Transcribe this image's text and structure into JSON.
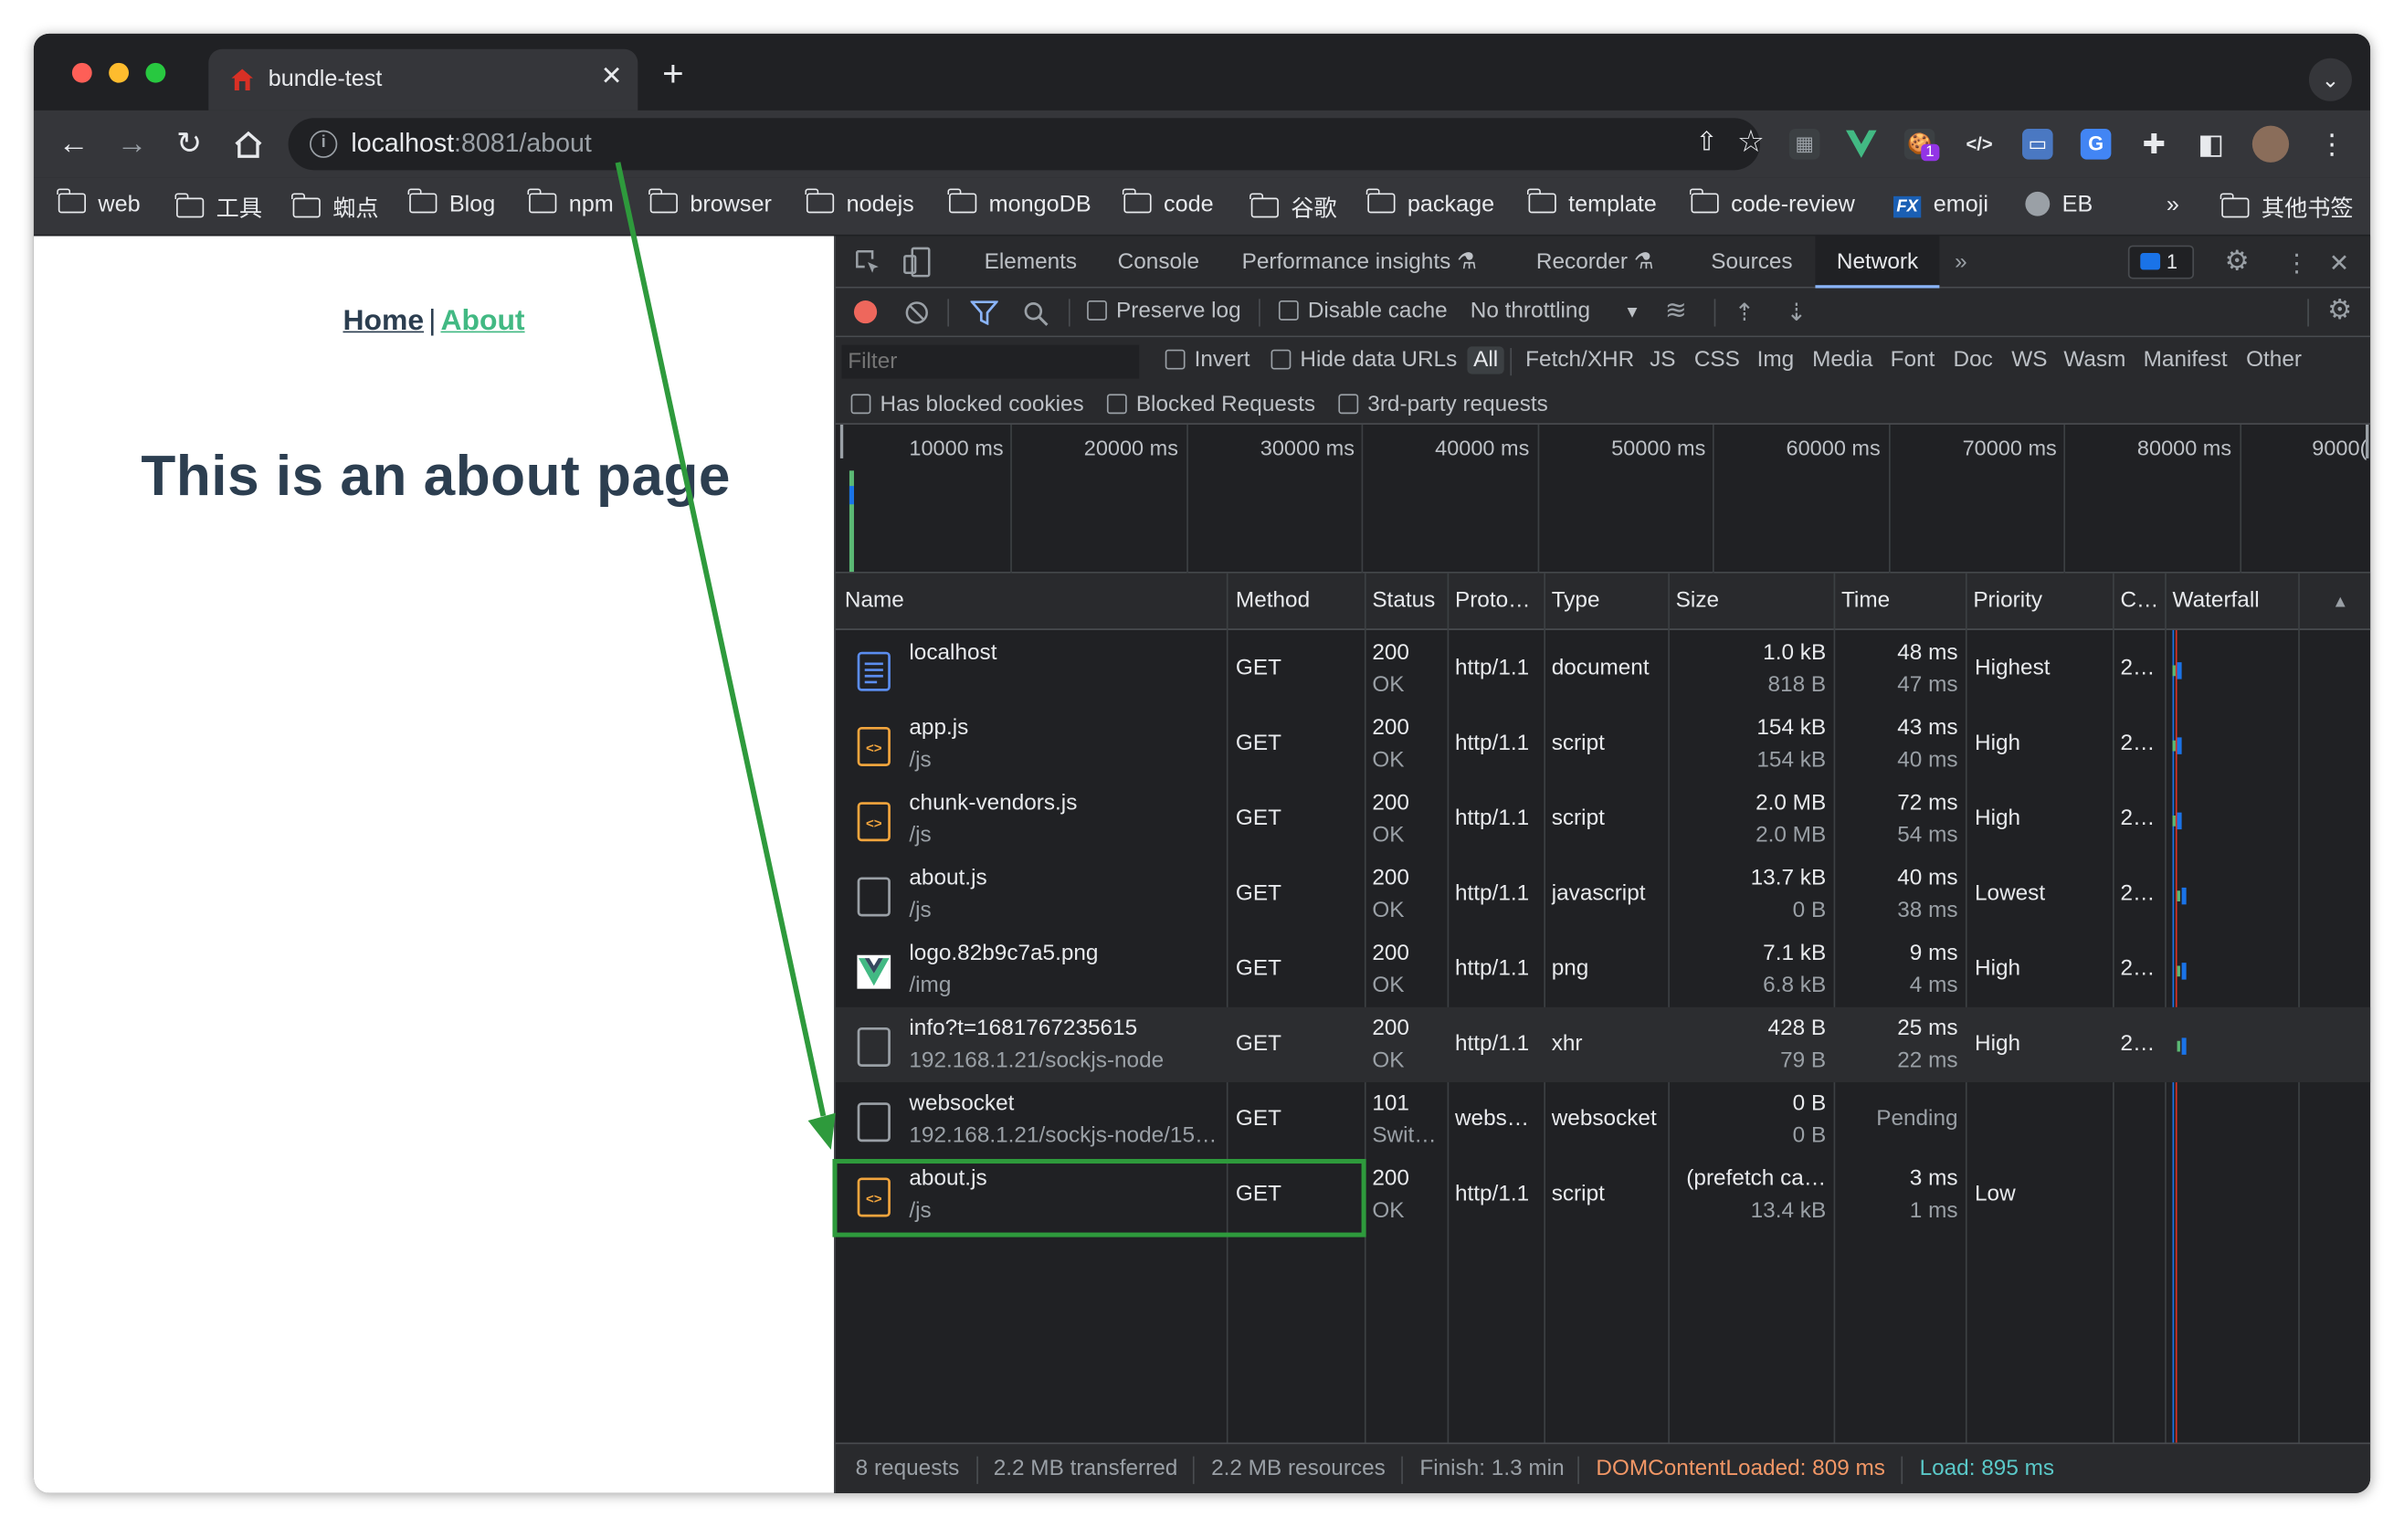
{
  "browser": {
    "tab_title": "bundle-test",
    "tab_close": "✕",
    "new_tab": "+",
    "tab_menu": "⌄",
    "url_host": "localhost",
    "url_rest": ":8081/about",
    "extension_badge": "1"
  },
  "bookmarks": [
    {
      "label": "web"
    },
    {
      "label": "工具"
    },
    {
      "label": "蜘点"
    },
    {
      "label": "Blog"
    },
    {
      "label": "npm"
    },
    {
      "label": "browser"
    },
    {
      "label": "nodejs"
    },
    {
      "label": "mongoDB"
    },
    {
      "label": "code"
    },
    {
      "label": "谷歌"
    },
    {
      "label": "package"
    },
    {
      "label": "template"
    },
    {
      "label": "code-review"
    },
    {
      "label": "emoji"
    },
    {
      "label": "EB"
    }
  ],
  "bookmarks_more": "»",
  "bookmarks_other": "其他书签",
  "page": {
    "nav_home": "Home",
    "nav_sep": "|",
    "nav_about": "About",
    "heading": "This is an about page"
  },
  "devtools": {
    "tabs": [
      "Elements",
      "Console",
      "Performance insights",
      "Recorder",
      "Sources",
      "Network"
    ],
    "active_tab": "Network",
    "more_tabs": "»",
    "message_count": "1",
    "toolbar": {
      "preserve_log": "Preserve log",
      "disable_cache": "Disable cache",
      "throttling": "No throttling"
    },
    "filter": {
      "placeholder": "Filter",
      "invert": "Invert",
      "hide_data_urls": "Hide data URLs",
      "types": [
        "All",
        "Fetch/XHR",
        "JS",
        "CSS",
        "Img",
        "Media",
        "Font",
        "Doc",
        "WS",
        "Wasm",
        "Manifest",
        "Other"
      ],
      "has_blocked_cookies": "Has blocked cookies",
      "blocked_requests": "Blocked Requests",
      "third_party": "3rd-party requests"
    },
    "overview_ticks": [
      "10000 ms",
      "20000 ms",
      "30000 ms",
      "40000 ms",
      "50000 ms",
      "60000 ms",
      "70000 ms",
      "80000 ms",
      "9000("
    ],
    "columns": [
      "Name",
      "Method",
      "Status",
      "Proto…",
      "Type",
      "Size",
      "Time",
      "Priority",
      "C…",
      "Waterfall"
    ],
    "requests": [
      {
        "name": "localhost",
        "path": "",
        "method": "GET",
        "status": "200",
        "status_text": "OK",
        "protocol": "http/1.1",
        "type": "document",
        "size": "1.0 kB",
        "size2": "818 B",
        "time": "48 ms",
        "time2": "47 ms",
        "priority": "Highest",
        "c": "2…",
        "icon": "document-icon",
        "waterfall": 0.3
      },
      {
        "name": "app.js",
        "path": "/js",
        "method": "GET",
        "status": "200",
        "status_text": "OK",
        "protocol": "http/1.1",
        "type": "script",
        "size": "154 kB",
        "size2": "154 kB",
        "time": "43 ms",
        "time2": "40 ms",
        "priority": "High",
        "c": "2…",
        "icon": "script-icon",
        "waterfall": 0.3
      },
      {
        "name": "chunk-vendors.js",
        "path": "/js",
        "method": "GET",
        "status": "200",
        "status_text": "OK",
        "protocol": "http/1.1",
        "type": "script",
        "size": "2.0 MB",
        "size2": "2.0 MB",
        "time": "72 ms",
        "time2": "54 ms",
        "priority": "High",
        "c": "2…",
        "icon": "script-icon",
        "waterfall": 0.3
      },
      {
        "name": "about.js",
        "path": "/js",
        "method": "GET",
        "status": "200",
        "status_text": "OK",
        "protocol": "http/1.1",
        "type": "javascript",
        "size": "13.7 kB",
        "size2": "0 B",
        "time": "40 ms",
        "time2": "38 ms",
        "priority": "Lowest",
        "c": "2…",
        "icon": "blank-file-icon",
        "waterfall": 0.6
      },
      {
        "name": "logo.82b9c7a5.png",
        "path": "/img",
        "method": "GET",
        "status": "200",
        "status_text": "OK",
        "protocol": "http/1.1",
        "type": "png",
        "size": "7.1 kB",
        "size2": "6.8 kB",
        "time": "9 ms",
        "time2": "4 ms",
        "priority": "High",
        "c": "2…",
        "icon": "vue-logo-icon",
        "waterfall": 0.6
      },
      {
        "name": "info?t=1681767235615",
        "path": "192.168.1.21/sockjs-node",
        "method": "GET",
        "status": "200",
        "status_text": "OK",
        "protocol": "http/1.1",
        "type": "xhr",
        "size": "428 B",
        "size2": "79 B",
        "time": "25 ms",
        "time2": "22 ms",
        "priority": "High",
        "c": "2…",
        "icon": "blank-file-icon",
        "waterfall": 0.6
      },
      {
        "name": "websocket",
        "path": "192.168.1.21/sockjs-node/15…",
        "method": "GET",
        "status": "101",
        "status_text": "Swit…",
        "protocol": "webs…",
        "type": "websocket",
        "size": "0 B",
        "size2": "0 B",
        "time": "Pending",
        "time2": "",
        "priority": "",
        "c": "",
        "icon": "blank-file-icon",
        "waterfall": null
      },
      {
        "name": "about.js",
        "path": "/js",
        "method": "GET",
        "status": "200",
        "status_text": "OK",
        "protocol": "http/1.1",
        "type": "script",
        "size": "(prefetch ca…",
        "size2": "13.4 kB",
        "time": "3 ms",
        "time2": "1 ms",
        "priority": "Low",
        "c": "",
        "icon": "script-icon",
        "waterfall": null
      }
    ],
    "summary": {
      "requests": "8 requests",
      "transferred": "2.2 MB transferred",
      "resources": "2.2 MB resources",
      "finish": "Finish: 1.3 min",
      "dom_content_loaded": "DOMContentLoaded: 809 ms",
      "load": "Load: 895 ms"
    },
    "colors": {
      "dcl": "#f29766",
      "load": "#5ac8c8",
      "annotation": "#2e9a3c"
    }
  }
}
